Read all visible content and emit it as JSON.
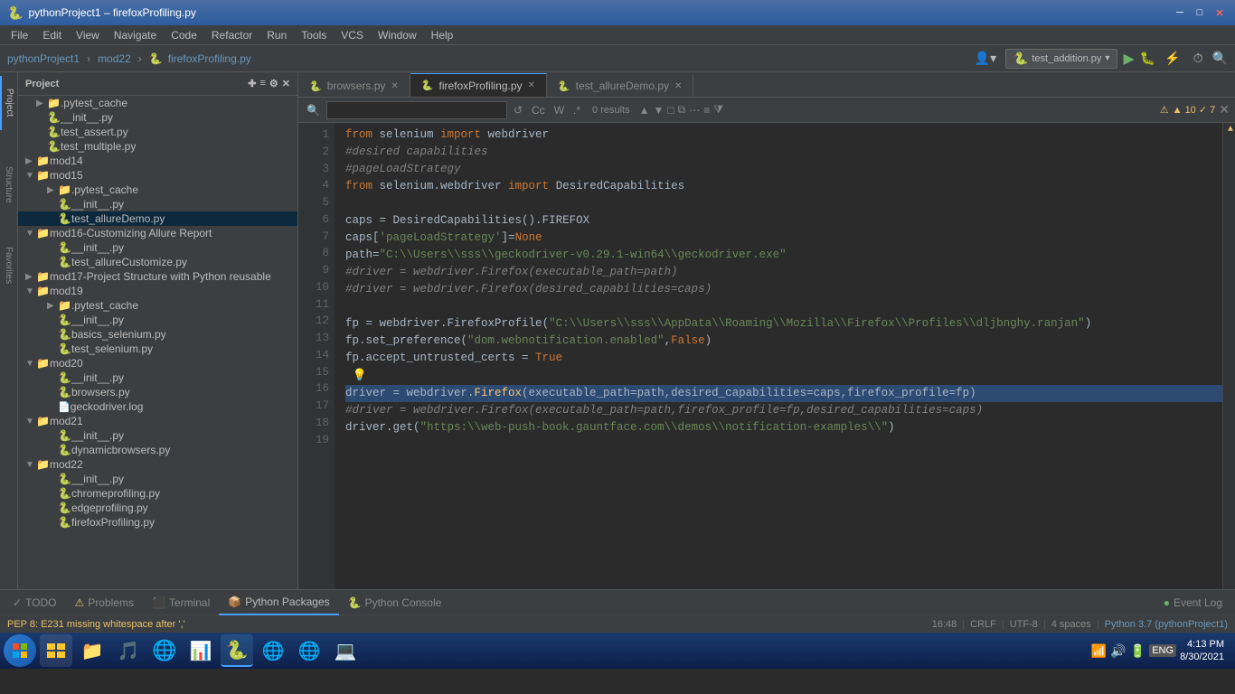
{
  "titleBar": {
    "title": "pythonProject1 – firefoxProfiling.py",
    "icon": "🐍",
    "minBtn": "─",
    "maxBtn": "□",
    "closeBtn": "✕"
  },
  "menuBar": {
    "items": [
      "File",
      "Edit",
      "View",
      "Navigate",
      "Code",
      "Refactor",
      "Run",
      "Tools",
      "VCS",
      "Window",
      "Help"
    ]
  },
  "toolbar": {
    "breadcrumbs": [
      "pythonProject1",
      "mod22",
      "firefoxProfiling.py"
    ],
    "runConfig": "test_addition.py",
    "searchPlaceholder": ""
  },
  "fileTree": {
    "header": "Project",
    "items": [
      {
        "indent": 2,
        "type": "folder",
        "name": ".pytest_cache",
        "expanded": false
      },
      {
        "indent": 2,
        "type": "file",
        "name": "__init__.py"
      },
      {
        "indent": 2,
        "type": "file",
        "name": "test_assert.py"
      },
      {
        "indent": 2,
        "type": "file",
        "name": "test_multiple.py"
      },
      {
        "indent": 1,
        "type": "folder",
        "name": "mod14",
        "expanded": false
      },
      {
        "indent": 1,
        "type": "folder",
        "name": "mod15",
        "expanded": true
      },
      {
        "indent": 2,
        "type": "folder",
        "name": ".pytest_cache",
        "expanded": false
      },
      {
        "indent": 2,
        "type": "file",
        "name": "__init__.py"
      },
      {
        "indent": 2,
        "type": "file",
        "name": "test_allureDemo.py",
        "selected": true
      },
      {
        "indent": 1,
        "type": "folder",
        "name": "mod16-Customizing Allure Report",
        "expanded": true
      },
      {
        "indent": 2,
        "type": "file",
        "name": "__init__.py"
      },
      {
        "indent": 2,
        "type": "file",
        "name": "test_allureCustomize.py"
      },
      {
        "indent": 1,
        "type": "folder",
        "name": "mod17-Project Structure with Python reusable",
        "expanded": false
      },
      {
        "indent": 1,
        "type": "folder",
        "name": "mod19",
        "expanded": true
      },
      {
        "indent": 2,
        "type": "folder",
        "name": ".pytest_cache",
        "expanded": false
      },
      {
        "indent": 2,
        "type": "file",
        "name": "__init__.py"
      },
      {
        "indent": 2,
        "type": "file",
        "name": "basics_selenium.py"
      },
      {
        "indent": 2,
        "type": "file",
        "name": "test_selenium.py"
      },
      {
        "indent": 1,
        "type": "folder",
        "name": "mod20",
        "expanded": true
      },
      {
        "indent": 2,
        "type": "file",
        "name": "__init__.py"
      },
      {
        "indent": 2,
        "type": "file",
        "name": "browsers.py"
      },
      {
        "indent": 2,
        "type": "file",
        "name": "geckodriver.log"
      },
      {
        "indent": 1,
        "type": "folder",
        "name": "mod21",
        "expanded": true
      },
      {
        "indent": 2,
        "type": "file",
        "name": "__init__.py"
      },
      {
        "indent": 2,
        "type": "file",
        "name": "dynamicbrowsers.py"
      },
      {
        "indent": 1,
        "type": "folder",
        "name": "mod22",
        "expanded": true
      },
      {
        "indent": 2,
        "type": "file",
        "name": "__init__.py"
      },
      {
        "indent": 2,
        "type": "file",
        "name": "chromeprofiling.py"
      },
      {
        "indent": 2,
        "type": "file",
        "name": "edgeprofiling.py"
      },
      {
        "indent": 2,
        "type": "file",
        "name": "firefoxProfiling.py"
      }
    ]
  },
  "tabs": [
    {
      "name": "browsers.py",
      "active": false,
      "icon": "🐍"
    },
    {
      "name": "firefoxProfiling.py",
      "active": true,
      "icon": "🐍"
    },
    {
      "name": "test_allureDemo.py",
      "active": false,
      "icon": "🐍"
    }
  ],
  "search": {
    "placeholder": "",
    "results": "0 results",
    "warningText": "▲ 10  ✓ 7"
  },
  "codeLines": [
    {
      "n": 1,
      "code": "from selenium import webdriver"
    },
    {
      "n": 2,
      "code": "#desired capabilities",
      "comment": true
    },
    {
      "n": 3,
      "code": "#pageLoadStrategy",
      "comment": true
    },
    {
      "n": 4,
      "code": "from selenium.webdriver import DesiredCapabilities"
    },
    {
      "n": 5,
      "code": ""
    },
    {
      "n": 6,
      "code": "caps = DesiredCapabilities().FIREFOX"
    },
    {
      "n": 7,
      "code": "caps['pageLoadStrategy']=None"
    },
    {
      "n": 8,
      "code": "path=\"C:\\\\Users\\\\sss\\\\geckodriver-v0.29.1-win64\\\\geckodriver.exe\""
    },
    {
      "n": 9,
      "code": "#driver = webdriver.Firefox(executable_path=path)",
      "comment": true
    },
    {
      "n": 10,
      "code": "#driver = webdriver.Firefox(desired_capabilities=caps)",
      "comment": true
    },
    {
      "n": 11,
      "code": ""
    },
    {
      "n": 12,
      "code": "fp = webdriver.FirefoxProfile(\"C:\\\\Users\\\\sss\\\\AppData\\\\Roaming\\\\Mozilla\\\\Firefox\\\\Profiles\\\\dljbnghy.ranjan\")"
    },
    {
      "n": 13,
      "code": "fp.set_preference(\"dom.webnotification.enabled\",False)"
    },
    {
      "n": 14,
      "code": "fp.accept_untrusted_certs = True"
    },
    {
      "n": 15,
      "code": ""
    },
    {
      "n": 16,
      "code": "driver = webdriver.Firefox(executable_path=path,desired_capabilities=caps,firefox_profile=fp)"
    },
    {
      "n": 17,
      "code": "#driver = webdriver.Firefox(executable_path=path,firefox_profile=fp,desired_capabilities=caps)",
      "comment": true
    },
    {
      "n": 18,
      "code": "driver.get(\"https:\\\\web-push-book.gauntface.com\\\\demos\\\\notification-examples\\\\\")"
    },
    {
      "n": 19,
      "code": ""
    }
  ],
  "statusBar": {
    "line": "16:48",
    "crlf": "CRLF",
    "encoding": "UTF-8",
    "indent": "4 spaces",
    "python": "Python 3.7 (pythonProject1)",
    "todo": "TODO",
    "problems": "Problems",
    "terminal": "Terminal",
    "pythonPackages": "Python Packages",
    "pythonConsole": "Python Console",
    "eventLog": "Event Log"
  },
  "pep8": {
    "message": "PEP 8: E231 missing whitespace after ','"
  },
  "taskbar": {
    "apps": [
      "🪟",
      "📁",
      "🎵",
      "🌐",
      "📊",
      "🐍",
      "🌐",
      "🌐",
      "💻"
    ],
    "time": "4:13 PM",
    "date": "8/30/2021"
  }
}
